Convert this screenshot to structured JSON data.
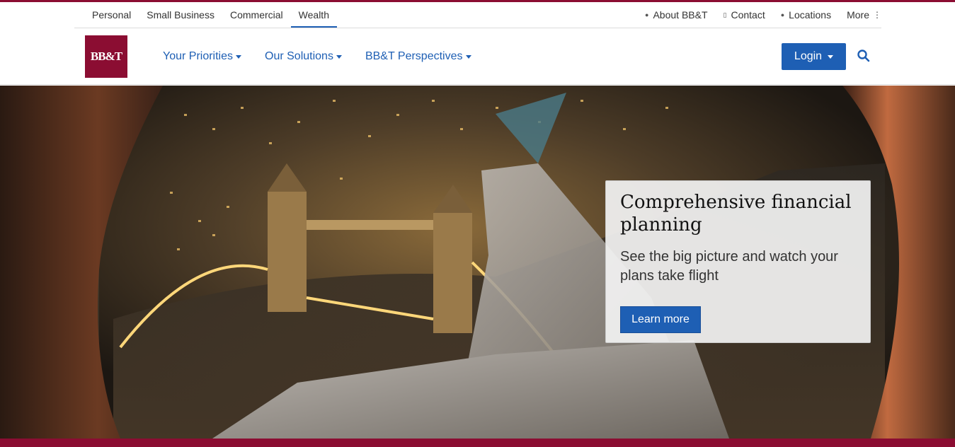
{
  "colors": {
    "brand": "#8b0d32",
    "accent": "#1e5fb4"
  },
  "utility_nav": {
    "segments": [
      "Personal",
      "Small Business",
      "Commercial",
      "Wealth"
    ],
    "active_segment": "Wealth",
    "links": [
      {
        "label": "About BB&T",
        "icon": "person-icon"
      },
      {
        "label": "Contact",
        "icon": "phone-icon"
      },
      {
        "label": "Locations",
        "icon": "map-pin-icon"
      },
      {
        "label": "More",
        "icon": "vertical-dots-icon"
      }
    ]
  },
  "header": {
    "logo_text": "BB&T",
    "nav": [
      "Your Priorities",
      "Our Solutions",
      "BB&T Perspectives"
    ],
    "login_label": "Login",
    "search_icon": "search-icon"
  },
  "hero": {
    "title": "Comprehensive financial planning",
    "subtitle": "See the big picture and watch your plans take flight",
    "cta_label": "Learn more"
  }
}
